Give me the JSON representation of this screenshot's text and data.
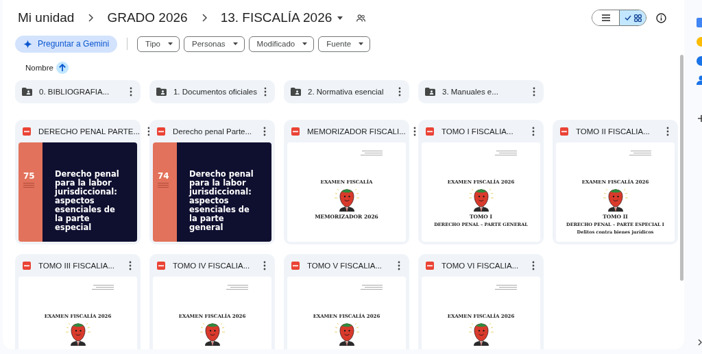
{
  "breadcrumb": {
    "path": [
      "Mi unidad",
      "GRADO 2026"
    ],
    "current": "13. FISCALÍA 2026"
  },
  "view_toggle": [
    {
      "kind": "list",
      "selected": false
    },
    {
      "kind": "grid",
      "selected": true
    }
  ],
  "gemini_button": "Preguntar a Gemini",
  "filters": [
    "Tipo",
    "Personas",
    "Modificado",
    "Fuente"
  ],
  "sort": {
    "label": "Nombre"
  },
  "folders": [
    "0. BIBLIOGRAFIA...",
    "1. Documentos oficiales",
    "2. Normativa esencial",
    "3. Manuales e..."
  ],
  "files": [
    {
      "name": "DERECHO PENAL PARTE...",
      "preview": {
        "kind": "cover",
        "number": "75",
        "title": "Derecho penal para la labor jurisdiccional: aspectos esenciales de la parte especial"
      }
    },
    {
      "name": "Derecho penal Parte...",
      "preview": {
        "kind": "cover",
        "number": "74",
        "title": "Derecho penal para la labor jurisdiccional: aspectos esenciales de la parte general"
      }
    },
    {
      "name": "MEMORIZADOR FISCALI...",
      "preview": {
        "kind": "page",
        "heading": "EXAMEN FISCALÍA",
        "lines": [
          "MEMORIZADOR 2026"
        ]
      }
    },
    {
      "name": "TOMO I FISCALIA...",
      "preview": {
        "kind": "page",
        "heading": "EXAMEN FISCALÍA 2026",
        "lines": [
          "TOMO I",
          "DERECHO PENAL – PARTE GENERAL"
        ]
      }
    },
    {
      "name": "TOMO II FISCALIA...",
      "preview": {
        "kind": "page",
        "heading": "EXAMEN FISCALÍA 2026",
        "lines": [
          "TOMO II",
          "DERECHO PENAL – PARTE ESPECIAL I",
          "Delitos contra bienes jurídicos"
        ]
      }
    },
    {
      "name": "TOMO III FISCALIA...",
      "preview": {
        "kind": "page",
        "heading": "EXAMEN FISCALÍA 2026"
      }
    },
    {
      "name": "TOMO IV FISCALIA...",
      "preview": {
        "kind": "page",
        "heading": "EXAMEN FISCALÍA 2026"
      }
    },
    {
      "name": "TOMO V FISCALIA...",
      "preview": {
        "kind": "page",
        "heading": "EXAMEN FISCALÍA 2026"
      }
    },
    {
      "name": "TOMO VI FISCALIA...",
      "preview": {
        "kind": "page",
        "heading": "EXAMEN FISCALÍA 2026"
      }
    }
  ]
}
